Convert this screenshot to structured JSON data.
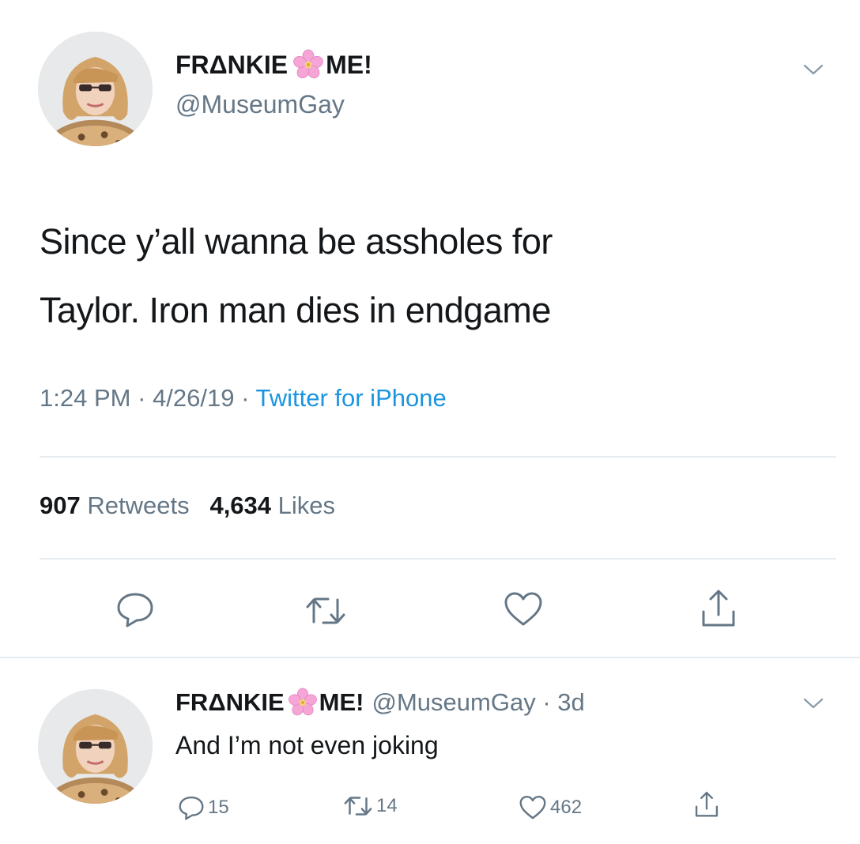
{
  "tweet": {
    "display_name_first": "FRΔNKIE",
    "display_name_second": "ME!",
    "handle": "@MuseumGay",
    "text_lines": [
      "Since y’all wanna be assholes for",
      "Taylor. Iron man dies in endgame"
    ],
    "time": "1:24 PM",
    "date": "4/26/19",
    "separator": "·",
    "source": "Twitter for iPhone",
    "retweets_count": "907",
    "retweets_label": "Retweets",
    "likes_count": "4,634",
    "likes_label": "Likes"
  },
  "reply": {
    "display_name_first": "FRΔNKIE",
    "display_name_second": "ME!",
    "handle": "@MuseumGay",
    "separator": "·",
    "age": "3d",
    "text": "And I’m not even joking",
    "replies_count": "15",
    "retweets_count": "14",
    "likes_count": "462"
  },
  "icons": {
    "name_emoji": "cherry-blossom-icon",
    "menu": "chevron-down-icon",
    "reply": "reply-icon",
    "retweet": "retweet-icon",
    "like": "heart-icon",
    "share": "share-icon"
  },
  "colors": {
    "text": "#14171a",
    "secondary": "#657786",
    "link": "#1b95e0",
    "divider": "#e6ecf0",
    "flower": "#f7a8d8"
  }
}
